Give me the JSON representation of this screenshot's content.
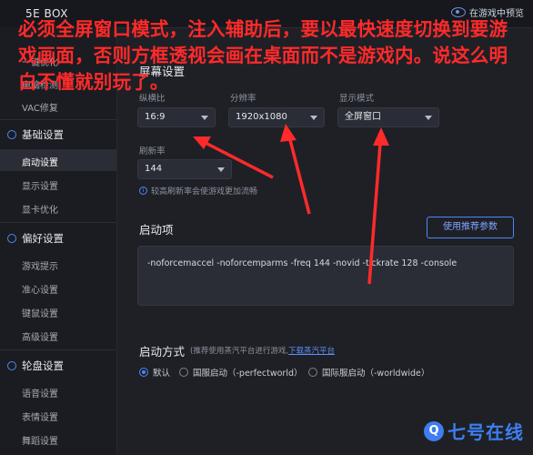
{
  "titlebar": {
    "title": "5E BOX",
    "preview": "在游戏中预览"
  },
  "sidebar": {
    "items_top": [
      "一键优化",
      "电脑检测",
      "VAC修复"
    ],
    "groups": [
      {
        "title": "基础设置",
        "items": [
          "启动设置",
          "显示设置",
          "显卡优化"
        ]
      },
      {
        "title": "偏好设置",
        "items": [
          "游戏提示",
          "准心设置",
          "键鼠设置",
          "高级设置"
        ]
      },
      {
        "title": "轮盘设置",
        "items": [
          "语音设置",
          "表情设置",
          "舞蹈设置"
        ]
      }
    ],
    "active": "启动设置"
  },
  "screen": {
    "title": "屏幕设置",
    "aspect_label": "纵横比",
    "aspect_value": "16:9",
    "resolution_label": "分辨率",
    "resolution_value": "1920x1080",
    "display_mode_label": "显示模式",
    "display_mode_value": "全屏窗口",
    "refresh_label": "刷新率",
    "refresh_value": "144",
    "refresh_hint": "较高刷新率会使游戏更加流畅"
  },
  "launch_options": {
    "title": "启动项",
    "recommend_button": "使用推荐参数",
    "params": "-noforcemaccel -noforcemparms -freq 144 -novid -tickrate 128 -console"
  },
  "launch_method": {
    "title": "启动方式",
    "note": "(推荐使用蒸汽平台进行游戏,",
    "link": "下载蒸汽平台",
    "options": [
      "默认",
      "国服启动（-perfectworld）",
      "国际服启动（-worldwide）"
    ],
    "selected": "默认"
  },
  "overlay": {
    "text": "必须全屏窗口模式，注入辅助后，要以最快速度切换到要游戏画面，否则方框透视会画在桌面而不是游戏内。说这么明白不懂就别玩了。",
    "color": "#ff2a2a"
  },
  "watermark": {
    "logo": "Q",
    "text": "七号在线"
  }
}
